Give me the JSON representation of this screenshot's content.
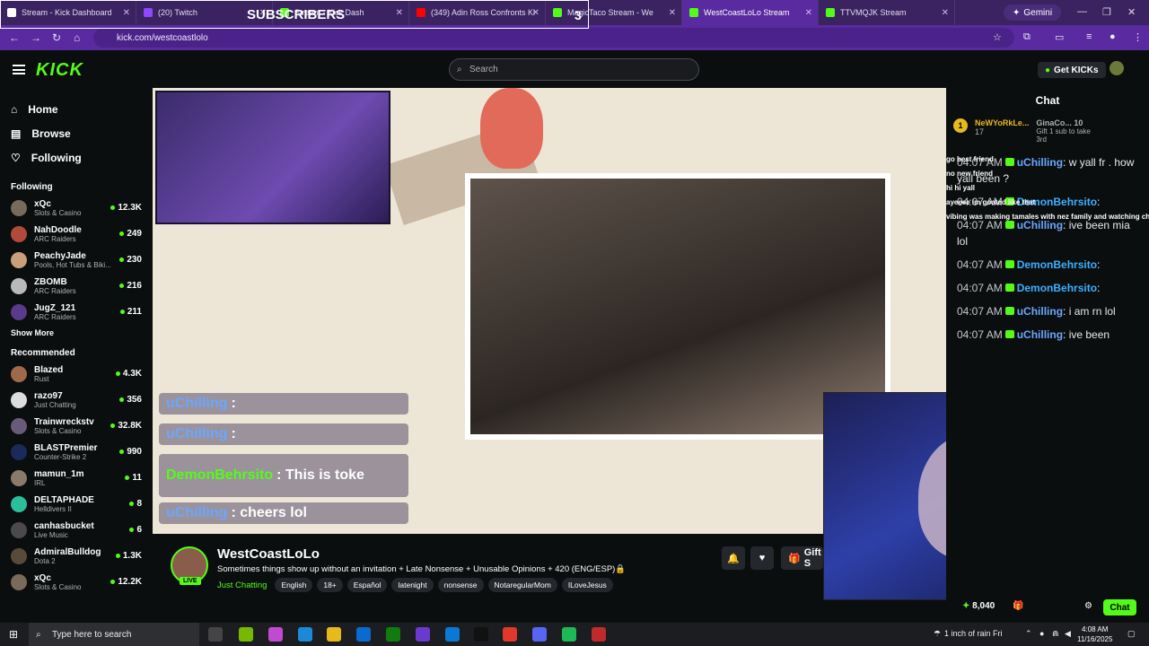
{
  "tabs": [
    {
      "label": "Stream - Kick Dashboard",
      "color": "#ffffff"
    },
    {
      "label": "(20) Twitch",
      "color": "#9146ff"
    },
    {
      "label": "Stream - Kick Dash",
      "color": "#53fc18"
    },
    {
      "label": "(349) Adin Ross Confronts Ki",
      "color": "#ff0000"
    },
    {
      "label": "MagicTaco Stream - We",
      "color": "#53fc18"
    },
    {
      "label": "WestCoastLoLo Stream",
      "color": "#53fc18"
    },
    {
      "label": "TTVMQJK Stream",
      "color": "#53fc18"
    }
  ],
  "browser": {
    "gemini": "Gemini",
    "url": "kick.com/westcoastlolo"
  },
  "overlay": {
    "subscribers_label": "SUBSCRIBERS",
    "subscribers_count": "3"
  },
  "header": {
    "logo": "KICK",
    "search_placeholder": "Search",
    "get_kicks": "Get KICKs"
  },
  "nav": {
    "home": "Home",
    "browse": "Browse",
    "following": "Following"
  },
  "following_heading": "Following",
  "following": [
    {
      "name": "xQc",
      "category": "Slots & Casino",
      "viewers": "12.3K",
      "color": "#7a6a5a"
    },
    {
      "name": "NahDoodle",
      "category": "ARC Raiders",
      "viewers": "249",
      "color": "#b04a3a"
    },
    {
      "name": "PeachyJade",
      "category": "Pools, Hot Tubs & Biki...",
      "viewers": "230",
      "color": "#c9a07a"
    },
    {
      "name": "ZBOMB",
      "category": "ARC Raiders",
      "viewers": "216",
      "color": "#b9b9b9"
    },
    {
      "name": "JugZ_121",
      "category": "ARC Raiders",
      "viewers": "211",
      "color": "#5a3a8a"
    }
  ],
  "show_more": "Show More",
  "recommended_heading": "Recommended",
  "recommended": [
    {
      "name": "Blazed",
      "category": "Rust",
      "viewers": "4.3K",
      "color": "#a06a4a"
    },
    {
      "name": "razo97",
      "category": "Just Chatting",
      "viewers": "356",
      "color": "#dddddd"
    },
    {
      "name": "Trainwreckstv",
      "category": "Slots & Casino",
      "viewers": "32.8K",
      "color": "#6a5a7a"
    },
    {
      "name": "BLASTPremier",
      "category": "Counter-Strike 2",
      "viewers": "990",
      "color": "#1a2a5a"
    },
    {
      "name": "mamun_1m",
      "category": "IRL",
      "viewers": "11",
      "color": "#8a7a6a"
    },
    {
      "name": "DELTAPHADE",
      "category": "Helldivers II",
      "viewers": "8",
      "color": "#2abf9a"
    },
    {
      "name": "canhasbucket",
      "category": "Live Music",
      "viewers": "6",
      "color": "#4a4a4a"
    },
    {
      "name": "AdmiralBulldog",
      "category": "Dota 2",
      "viewers": "1.3K",
      "color": "#5a4a3a"
    },
    {
      "name": "xQc",
      "category": "Slots & Casino",
      "viewers": "12.2K",
      "color": "#7a6a5a"
    }
  ],
  "stream_overlay_chat": [
    {
      "user": "uChilling",
      "text": ":"
    },
    {
      "user": "uChilling",
      "text": ":"
    },
    {
      "user": "DemonBehrsito",
      "text": ": This is toke"
    },
    {
      "user": "uChilling",
      "text": ": cheers lol"
    }
  ],
  "stream": {
    "name": "WestCoastLoLo",
    "title": "Sometimes things show up without an invitation + Late Nonsense + Unusable Opinions + 420 (ENG/ESP)🔒",
    "live": "LIVE",
    "category": "Just Chatting",
    "tags": [
      "English",
      "18+",
      "Español",
      "latenight",
      "nonsense",
      "NotaregularMom",
      "ILoveJesus"
    ],
    "gift": "Gift S"
  },
  "chat": {
    "heading": "Chat",
    "pinned_user": "NeWYoRkLe...",
    "pinned_count": "17",
    "gifter": "GinaCo...",
    "gifter_count": "10",
    "gift_text": "Gift 1 sub to take 3rd",
    "overlay_lines": [
      "go best friend",
      "no new friend",
      "hi hi yall",
      "ayeeee im goated like that",
      "vibing was making tamales with nez family and watching chris"
    ],
    "messages": [
      {
        "time": "04:07 AM",
        "user": "uChilling",
        "text": ": w yall fr . how yall been ?"
      },
      {
        "time": "04:07 AM",
        "user": "DemonBehrsito",
        "text": ":"
      },
      {
        "time": "04:07 AM",
        "user": "uChilling",
        "text": ": ive been mia lol"
      },
      {
        "time": "04:07 AM",
        "user": "DemonBehrsito",
        "text": ":"
      },
      {
        "time": "04:07 AM",
        "user": "DemonBehrsito",
        "text": ":"
      },
      {
        "time": "04:07 AM",
        "user": "uChilling",
        "text": ": i am rn lol"
      },
      {
        "time": "04:07 AM",
        "user": "uChilling",
        "text": ": ive been"
      }
    ],
    "points": "8,040",
    "chat_button": "Chat"
  },
  "taskbar": {
    "search_placeholder": "Type here to search",
    "weather": "1 inch of rain Fri",
    "time": "4:08 AM",
    "date": "11/16/2025"
  }
}
